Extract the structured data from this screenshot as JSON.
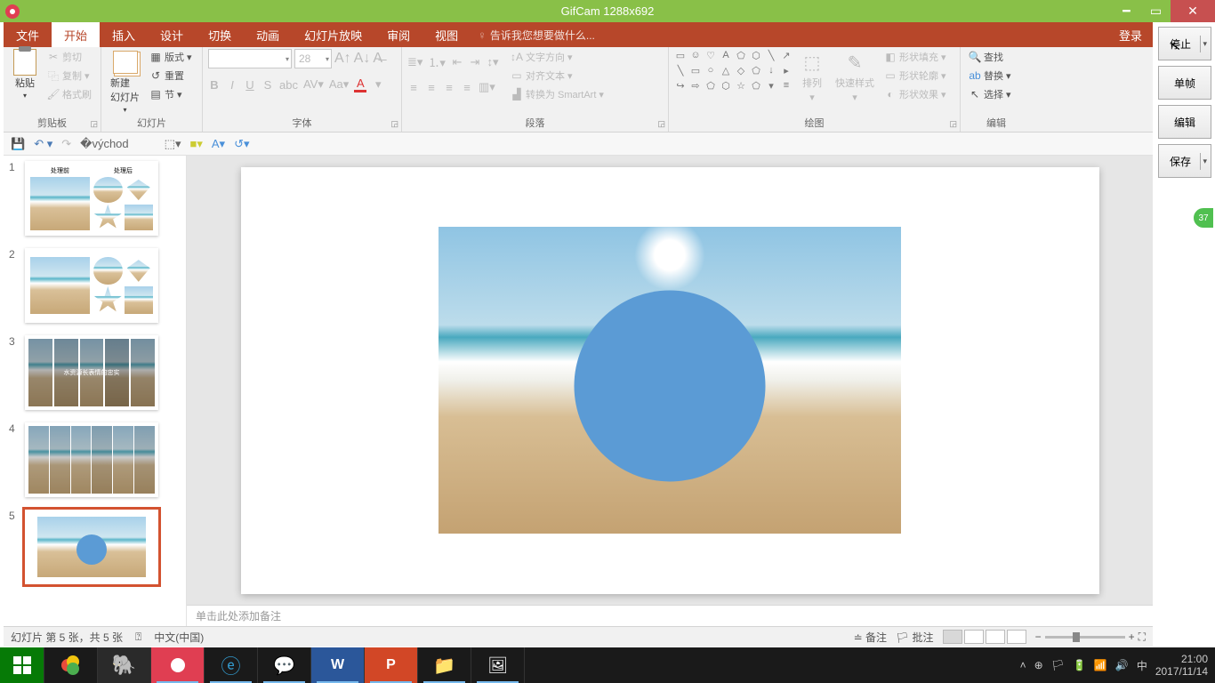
{
  "gifcam": {
    "title": "GifCam 1288x692",
    "btn_stop": "停止",
    "btn_frame": "单帧",
    "btn_edit": "编辑",
    "btn_save": "保存",
    "bubble": "37"
  },
  "tabs": {
    "file": "文件",
    "home": "开始",
    "insert": "插入",
    "design": "设计",
    "transitions": "切换",
    "animations": "动画",
    "slideshow": "幻灯片放映",
    "review": "审阅",
    "view": "视图",
    "tellme": "告诉我您想要做什么...",
    "login": "登录"
  },
  "ribbon": {
    "clipboard": {
      "label": "剪贴板",
      "paste": "粘贴",
      "cut": "剪切",
      "copy": "复制",
      "painter": "格式刷"
    },
    "slides": {
      "label": "幻灯片",
      "new": "新建\n幻灯片",
      "layout": "版式",
      "reset": "重置",
      "section": "节"
    },
    "font": {
      "label": "字体",
      "size": "28"
    },
    "para": {
      "label": "段落",
      "dir": "文字方向",
      "align": "对齐文本",
      "smart": "转换为 SmartArt"
    },
    "draw": {
      "label": "绘图",
      "arrange": "排列",
      "quick": "快速样式",
      "fill": "形状填充",
      "outline": "形状轮廓",
      "effects": "形状效果"
    },
    "edit": {
      "label": "编辑",
      "find": "查找",
      "replace": "替换",
      "select": "选择"
    }
  },
  "notes_placeholder": "单击此处添加备注",
  "status": {
    "slide": "幻灯片 第 5 张，共 5 张",
    "lang": "中文(中国)",
    "notes": "备注",
    "comments": "批注"
  },
  "thumbs": {
    "t1a": "处理前",
    "t1b": "处理后",
    "t3": "水资源长表情的忠实"
  },
  "clock": {
    "time": "21:00",
    "date": "2017/11/14"
  }
}
